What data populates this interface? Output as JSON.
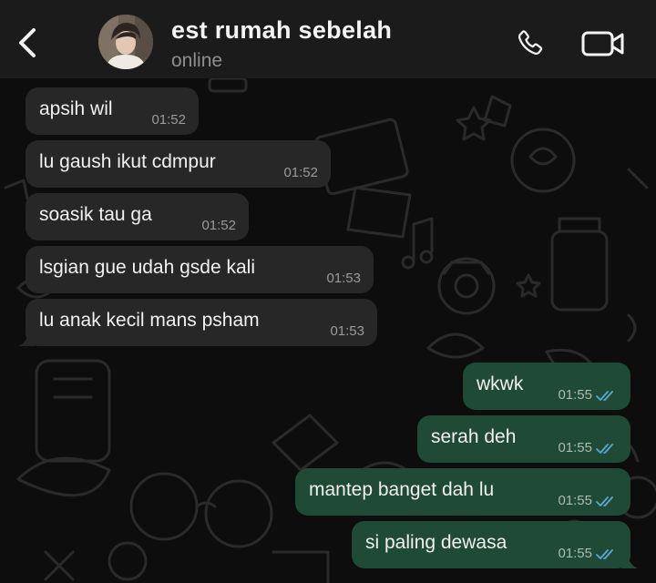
{
  "header": {
    "contact_name": "est rumah sebelah",
    "status": "online",
    "icons": {
      "back": "chevron-left-icon",
      "call": "phone-icon",
      "video": "video-camera-icon"
    }
  },
  "messages": {
    "incoming": [
      {
        "text": "apsih wil",
        "time": "01:52"
      },
      {
        "text": "lu gaush ikut cdmpur",
        "time": "01:52"
      },
      {
        "text": "soasik tau ga",
        "time": "01:52"
      },
      {
        "text": "lsgian gue udah gsde kali",
        "time": "01:53"
      },
      {
        "text": "lu anak kecil mans psham",
        "time": "01:53"
      }
    ],
    "outgoing": [
      {
        "text": "wkwk",
        "time": "01:55",
        "status": "read"
      },
      {
        "text": "serah deh",
        "time": "01:55",
        "status": "read"
      },
      {
        "text": "mantep banget dah lu",
        "time": "01:55",
        "status": "read"
      },
      {
        "text": "si paling dewasa",
        "time": "01:55",
        "status": "read"
      }
    ]
  },
  "colors": {
    "header_bg": "#1b1b1b",
    "incoming_bubble": "#272727",
    "outgoing_bubble": "#1f4a36",
    "read_ticks": "#5aa7d6"
  }
}
